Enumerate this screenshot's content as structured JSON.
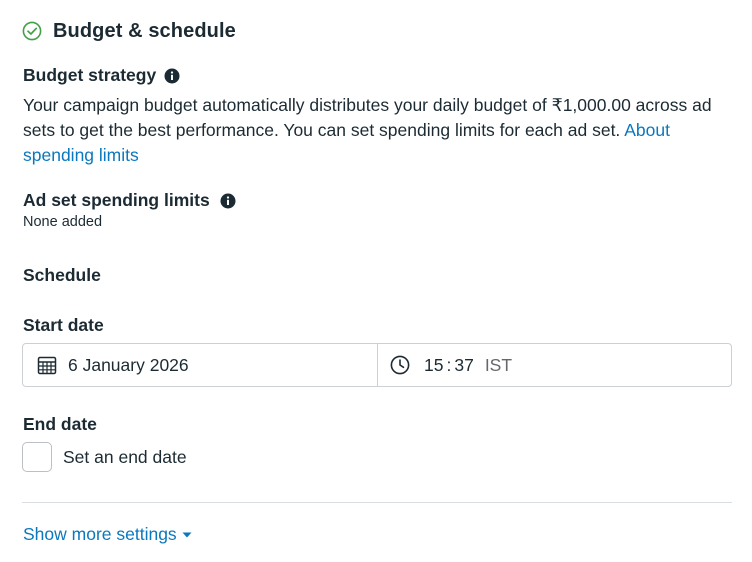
{
  "section": {
    "title": "Budget & schedule",
    "status_color": "#43a047"
  },
  "budget_strategy": {
    "label": "Budget strategy",
    "description": "Your campaign budget automatically distributes your daily budget of ₹1,000.00 across ad sets to get the best performance. You can set spending limits for each ad set.",
    "link_text": "About spending limits"
  },
  "ad_set_limits": {
    "label": "Ad set spending limits",
    "value": "None added"
  },
  "schedule": {
    "label": "Schedule",
    "start_date": {
      "label": "Start date",
      "date": "6 January 2026",
      "hour": "15",
      "separator": ":",
      "minute": "37",
      "timezone": "IST"
    },
    "end_date": {
      "label": "End date",
      "checkbox_label": "Set an end date",
      "checked": false
    }
  },
  "footer": {
    "show_more_label": "Show more settings"
  },
  "colors": {
    "link": "#0a78be",
    "text": "#1c2b33",
    "border": "#ccd0d5"
  }
}
